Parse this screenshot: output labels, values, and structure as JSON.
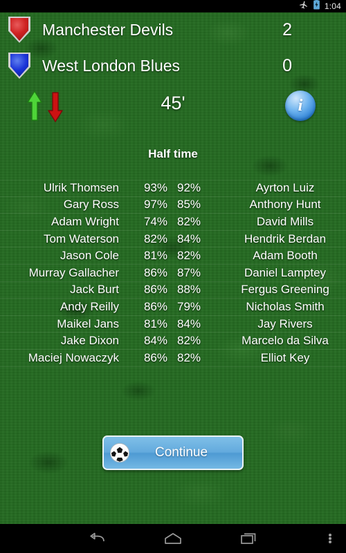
{
  "status_bar": {
    "airplane_icon": "airplane-mode-icon",
    "battery_icon": "battery-charging-icon",
    "clock": "1:04"
  },
  "scoreboard": {
    "home": {
      "team": "Manchester Devils",
      "score": "2",
      "badge_color": "#cf2222",
      "badge_icon": "shield-badge-red"
    },
    "away": {
      "team": "West London Blues",
      "score": "0",
      "badge_color": "#1b33d8",
      "badge_icon": "shield-badge-blue"
    }
  },
  "controls": {
    "sub_on_icon": "arrow-up-icon",
    "sub_on_color": "#4ed438",
    "sub_off_icon": "arrow-down-icon",
    "sub_off_color": "#cc1212",
    "minute": "45'",
    "info_icon": "info-icon",
    "info_label": "i"
  },
  "match_status": "Half time",
  "player_table": {
    "rows": [
      {
        "home_name": "Ulrik Thomsen",
        "home_pct": "93%",
        "away_pct": "92%",
        "away_name": "Ayrton Luiz"
      },
      {
        "home_name": "Gary Ross",
        "home_pct": "97%",
        "away_pct": "85%",
        "away_name": "Anthony Hunt"
      },
      {
        "home_name": "Adam Wright",
        "home_pct": "74%",
        "away_pct": "82%",
        "away_name": "David Mills"
      },
      {
        "home_name": "Tom Waterson",
        "home_pct": "82%",
        "away_pct": "84%",
        "away_name": "Hendrik Berdan"
      },
      {
        "home_name": "Jason Cole",
        "home_pct": "81%",
        "away_pct": "82%",
        "away_name": "Adam Booth"
      },
      {
        "home_name": "Murray Gallacher",
        "home_pct": "86%",
        "away_pct": "87%",
        "away_name": "Daniel Lamptey"
      },
      {
        "home_name": "Jack Burt",
        "home_pct": "86%",
        "away_pct": "88%",
        "away_name": "Fergus Greening"
      },
      {
        "home_name": "Andy Reilly",
        "home_pct": "86%",
        "away_pct": "79%",
        "away_name": "Nicholas Smith"
      },
      {
        "home_name": "Maikel Jans",
        "home_pct": "81%",
        "away_pct": "84%",
        "away_name": "Jay Rivers"
      },
      {
        "home_name": "Jake Dixon",
        "home_pct": "84%",
        "away_pct": "82%",
        "away_name": "Marcelo da Silva"
      },
      {
        "home_name": "Maciej Nowaczyk",
        "home_pct": "86%",
        "away_pct": "82%",
        "away_name": "Elliot Key"
      }
    ]
  },
  "continue_button": {
    "label": "Continue",
    "icon": "soccer-ball-icon"
  },
  "nav_bar": {
    "back_icon": "back-arrow-icon",
    "home_icon": "home-icon",
    "recents_icon": "recent-apps-icon",
    "menu_icon": "overflow-menu-icon"
  },
  "colors": {
    "pitch": "#256b22",
    "button": "#63aadd",
    "text": "#ffffff"
  }
}
